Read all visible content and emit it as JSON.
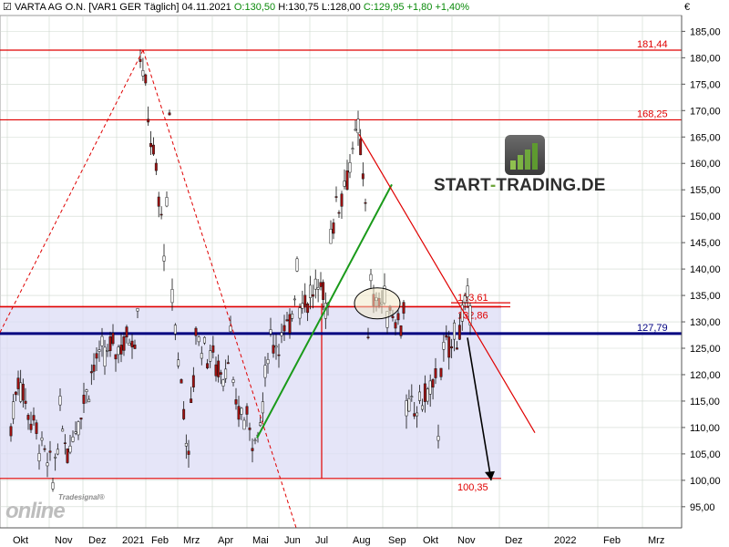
{
  "header": {
    "instrument": "VARTA AG O.N. [VAR1 GER",
    "period": "Täglich]",
    "date": "04.11.2021",
    "open": "O:130,50",
    "high": "H:130,75",
    "low": "L:128,00",
    "close": "C:129,95",
    "change": "+1,80",
    "change_pct": "+1,40%",
    "currency": "€"
  },
  "watermark": {
    "brand_part1": "START",
    "brand_sep": "-",
    "brand_part2": "TRADING.DE",
    "provider_small": "Tradesignal®",
    "provider_big": "online"
  },
  "colors": {
    "up_candle": "#ffffff",
    "down_candle": "#a01010",
    "resistance": "#e00000",
    "key_level": "#000080",
    "trendline_up": "#1a9a1a",
    "trendline_down": "#e00000",
    "range_fill": "#dcdcf5",
    "grid": "#cfd8cf"
  },
  "chart_data": {
    "type": "candlestick",
    "x_axis_labels": [
      "Okt",
      "Nov",
      "Dez",
      "2021",
      "Feb",
      "Mrz",
      "Apr",
      "Mai",
      "Jun",
      "Jul",
      "Aug",
      "Sep",
      "Okt",
      "Nov",
      "Dez",
      "2022",
      "Feb",
      "Mrz"
    ],
    "y_ticks": [
      "185,00",
      "180,00",
      "175,00",
      "170,00",
      "165,00",
      "160,00",
      "155,00",
      "150,00",
      "145,00",
      "140,00",
      "135,00",
      "130,00",
      "125,00",
      "120,00",
      "115,00",
      "110,00",
      "105,00",
      "100,00",
      "95,00"
    ],
    "ylim": [
      91,
      188
    ],
    "price_path": [
      [
        "Okt",
        110
      ],
      [
        "Okt",
        120
      ],
      [
        "Okt",
        115
      ],
      [
        "Nov",
        100
      ],
      [
        "Nov",
        112
      ],
      [
        "Nov",
        106
      ],
      [
        "Dez",
        117
      ],
      [
        "Dez",
        122
      ],
      [
        "2021",
        128
      ],
      [
        "2021",
        133
      ],
      [
        "2021",
        181.44
      ],
      [
        "Feb",
        145
      ],
      [
        "Feb",
        150
      ],
      [
        "Feb",
        168.25
      ],
      [
        "Feb",
        135
      ],
      [
        "Mrz",
        118
      ],
      [
        "Mrz",
        105
      ],
      [
        "Mrz",
        128
      ],
      [
        "Apr",
        122
      ],
      [
        "Apr",
        120
      ],
      [
        "Apr",
        127
      ],
      [
        "Apr",
        115
      ],
      [
        "Mai",
        108
      ],
      [
        "Mai",
        118
      ],
      [
        "Mai",
        126
      ],
      [
        "Jun",
        128
      ],
      [
        "Jun",
        142
      ],
      [
        "Jun",
        134
      ],
      [
        "Jul",
        136
      ],
      [
        "Jul",
        133
      ],
      [
        "Jul",
        148
      ],
      [
        "Aug",
        165.5
      ],
      [
        "Aug",
        155
      ],
      [
        "Aug",
        125
      ],
      [
        "Aug",
        136
      ],
      [
        "Sep",
        130
      ],
      [
        "Sep",
        133
      ],
      [
        "Sep",
        112
      ],
      [
        "Okt",
        118
      ],
      [
        "Okt",
        110
      ],
      [
        "Okt",
        122
      ],
      [
        "Nov",
        133.61
      ],
      [
        "Nov",
        129.95
      ]
    ],
    "horizontal_levels": [
      {
        "label": "181,44",
        "value": 181.44,
        "color": "resistance"
      },
      {
        "label": "168,25",
        "value": 168.25,
        "color": "resistance"
      },
      {
        "label": "133,61",
        "value": 133.61,
        "color": "resistance"
      },
      {
        "label": "132,86",
        "value": 132.86,
        "color": "resistance"
      },
      {
        "label": "127,79",
        "value": 127.79,
        "color": "key_level"
      },
      {
        "label": "100,35",
        "value": 100.35,
        "color": "resistance"
      }
    ],
    "range_box": {
      "top": 132.86,
      "bottom": 100.35
    },
    "trendlines": [
      {
        "kind": "uptrend",
        "from": [
          "Mai",
          108
        ],
        "to": [
          "Aug",
          156
        ]
      },
      {
        "kind": "downtrend",
        "from": [
          "Aug",
          165.5
        ],
        "to": [
          "Dez",
          109
        ]
      }
    ],
    "projection_arrow": {
      "from": [
        "Nov",
        127
      ],
      "to": [
        "Dez",
        100
      ]
    }
  }
}
